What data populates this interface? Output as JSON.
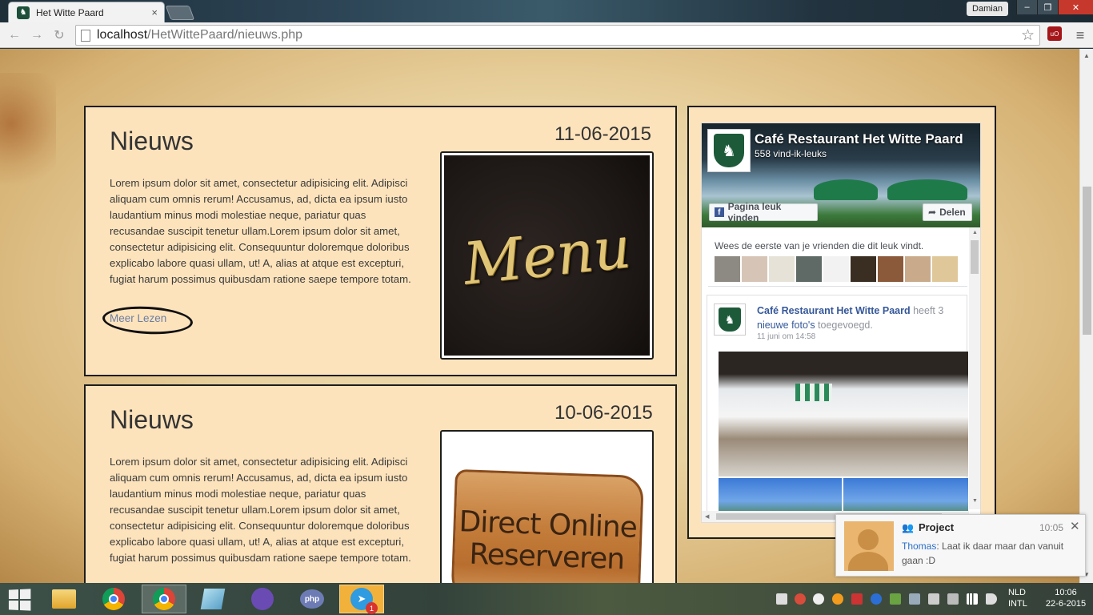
{
  "browser": {
    "tab_title": "Het Witte Paard",
    "tab_close": "×",
    "user": "Damian",
    "url_host": "localhost",
    "url_path": "/HetWittePaard/nieuws.php",
    "window_buttons": {
      "minimize": "–",
      "maximize": "❐",
      "close": "✕"
    },
    "extension_label": "uO"
  },
  "news": [
    {
      "title": "Nieuws",
      "date": "11-06-2015",
      "text": "Lorem ipsum dolor sit amet, consectetur adipisicing elit. Adipisci aliquam cum omnis rerum! Accusamus, ad, dicta ea ipsum iusto laudantium minus modi molestiae neque, pariatur quas recusandae suscipit tenetur ullam.Lorem ipsum dolor sit amet, consectetur adipisicing elit. Consequuntur doloremque doloribus explicabo labore quasi ullam, ut! A, alias at atque est excepturi, fugiat harum possimus quibusdam ratione saepe tempore totam.",
      "more_label": "Meer Lezen",
      "image_text": "Menu"
    },
    {
      "title": "Nieuws",
      "date": "10-06-2015",
      "text": "Lorem ipsum dolor sit amet, consectetur adipisicing elit. Adipisci aliquam cum omnis rerum! Accusamus, ad, dicta ea ipsum iusto laudantium minus modi molestiae neque, pariatur quas recusandae suscipit tenetur ullam.Lorem ipsum dolor sit amet, consectetur adipisicing elit. Consequuntur doloremque doloribus explicabo labore quasi ullam, ut! A, alias at atque est excepturi, fugiat harum possimus quibusdam ratione saepe tempore totam.",
      "image_text_line1": "Direct Online",
      "image_text_line2": "Reserveren"
    }
  ],
  "facebook": {
    "page_name": "Café Restaurant Het Witte Paard",
    "likes": "558 vind-ik-leuks",
    "like_button": "Pagina leuk vinden",
    "share_button": "Delen",
    "friends_text": "Wees de eerste van je vrienden die dit leuk vindt.",
    "post": {
      "page": "Café Restaurant Het Witte Paard",
      "verb": " heeft 3 ",
      "link": "nieuwe foto's",
      "suffix": " toegevoegd.",
      "time": "11 juni om 14:58"
    }
  },
  "toast": {
    "title": "Project",
    "time": "10:05",
    "sender": "Thomas",
    "message": ": Laat ik daar maar dan vanuit gaan :D",
    "close": "✕"
  },
  "taskbar": {
    "telegram_badge": "1",
    "php_label": "php",
    "lang_line1": "NLD",
    "lang_line2": "INTL",
    "clock_time": "10:06",
    "clock_date": "22-6-2015"
  },
  "colors": {
    "card_bg": "#fde3bc",
    "link": "#6b7ea5",
    "fb_blue": "#3b5998",
    "fb_link": "#365899"
  }
}
